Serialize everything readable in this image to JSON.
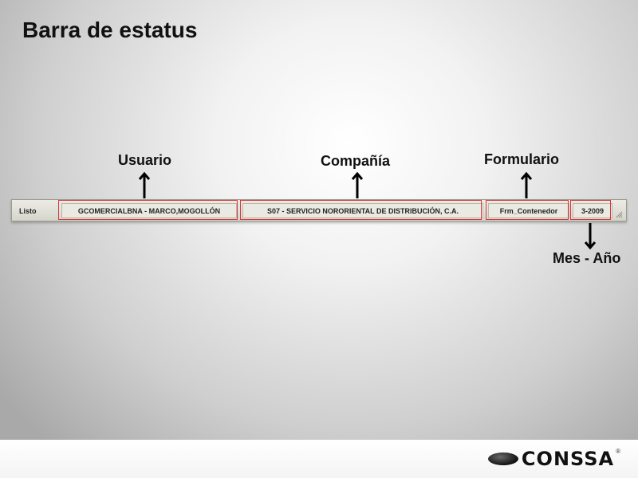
{
  "slide": {
    "title": "Barra de estatus"
  },
  "labels": {
    "usuario": "Usuario",
    "compania": "Compañía",
    "formulario": "Formulario",
    "mes_anio": "Mes - Año"
  },
  "statusbar": {
    "ready": "Listo",
    "user": "GCOMERCIALBNA - MARCO,MOGOLLÓN",
    "company": "S07 - SERVICIO NORORIENTAL DE DISTRIBUCIÓN, C.A.",
    "form": "Frm_Contenedor",
    "period": "3-2009"
  },
  "brand": {
    "name": "CONSSA",
    "mark": "®"
  },
  "colors": {
    "highlight": "#d9363e",
    "statusbar": "#dedcd2"
  }
}
